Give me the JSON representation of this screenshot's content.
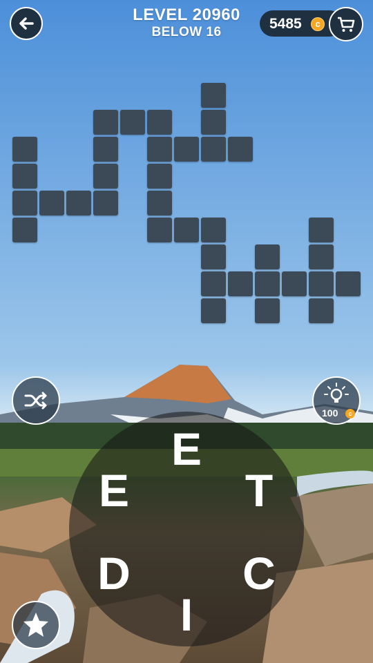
{
  "header": {
    "level": "LEVEL 20960",
    "subtitle": "BELOW 16",
    "coins": "5485",
    "coin_symbol": "c"
  },
  "controls": {
    "hint_cost": "100"
  },
  "puzzle": {
    "cell_count": 34
  },
  "wheel": {
    "letters": [
      "E",
      "T",
      "C",
      "I",
      "D",
      "E"
    ]
  },
  "colors": {
    "cell": "#3b4a56",
    "button_dark": "#1f3040",
    "coin": "#f5a623"
  }
}
